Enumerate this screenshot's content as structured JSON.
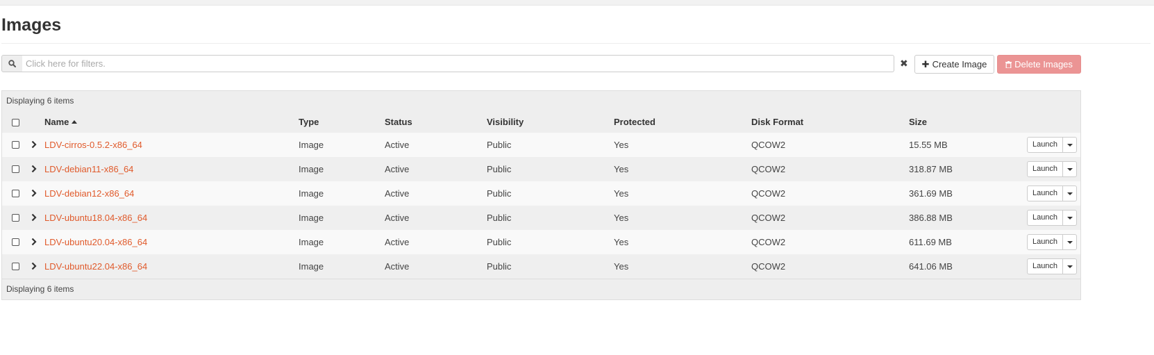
{
  "page": {
    "title": "Images"
  },
  "filter": {
    "placeholder": "Click here for filters."
  },
  "actions": {
    "create_label": "Create Image",
    "delete_label": "Delete Images",
    "create_icon": "plus-icon",
    "delete_icon": "trash-icon"
  },
  "table": {
    "count_text": "Displaying 6 items",
    "columns": {
      "name": "Name",
      "type": "Type",
      "status": "Status",
      "visibility": "Visibility",
      "protected": "Protected",
      "disk_format": "Disk Format",
      "size": "Size"
    },
    "sort_indicator": "ascending on Name",
    "launch_label": "Launch",
    "rows": [
      {
        "name": "LDV-cirros-0.5.2-x86_64",
        "type": "Image",
        "status": "Active",
        "visibility": "Public",
        "protected": "Yes",
        "disk_format": "QCOW2",
        "size": "15.55 MB"
      },
      {
        "name": "LDV-debian11-x86_64",
        "type": "Image",
        "status": "Active",
        "visibility": "Public",
        "protected": "Yes",
        "disk_format": "QCOW2",
        "size": "318.87 MB"
      },
      {
        "name": "LDV-debian12-x86_64",
        "type": "Image",
        "status": "Active",
        "visibility": "Public",
        "protected": "Yes",
        "disk_format": "QCOW2",
        "size": "361.69 MB"
      },
      {
        "name": "LDV-ubuntu18.04-x86_64",
        "type": "Image",
        "status": "Active",
        "visibility": "Public",
        "protected": "Yes",
        "disk_format": "QCOW2",
        "size": "386.88 MB"
      },
      {
        "name": "LDV-ubuntu20.04-x86_64",
        "type": "Image",
        "status": "Active",
        "visibility": "Public",
        "protected": "Yes",
        "disk_format": "QCOW2",
        "size": "611.69 MB"
      },
      {
        "name": "LDV-ubuntu22.04-x86_64",
        "type": "Image",
        "status": "Active",
        "visibility": "Public",
        "protected": "Yes",
        "disk_format": "QCOW2",
        "size": "641.06 MB"
      }
    ]
  },
  "colors": {
    "link": "#e05a2b",
    "danger_button": "#eb9494",
    "header_bg": "#eeeeee"
  }
}
